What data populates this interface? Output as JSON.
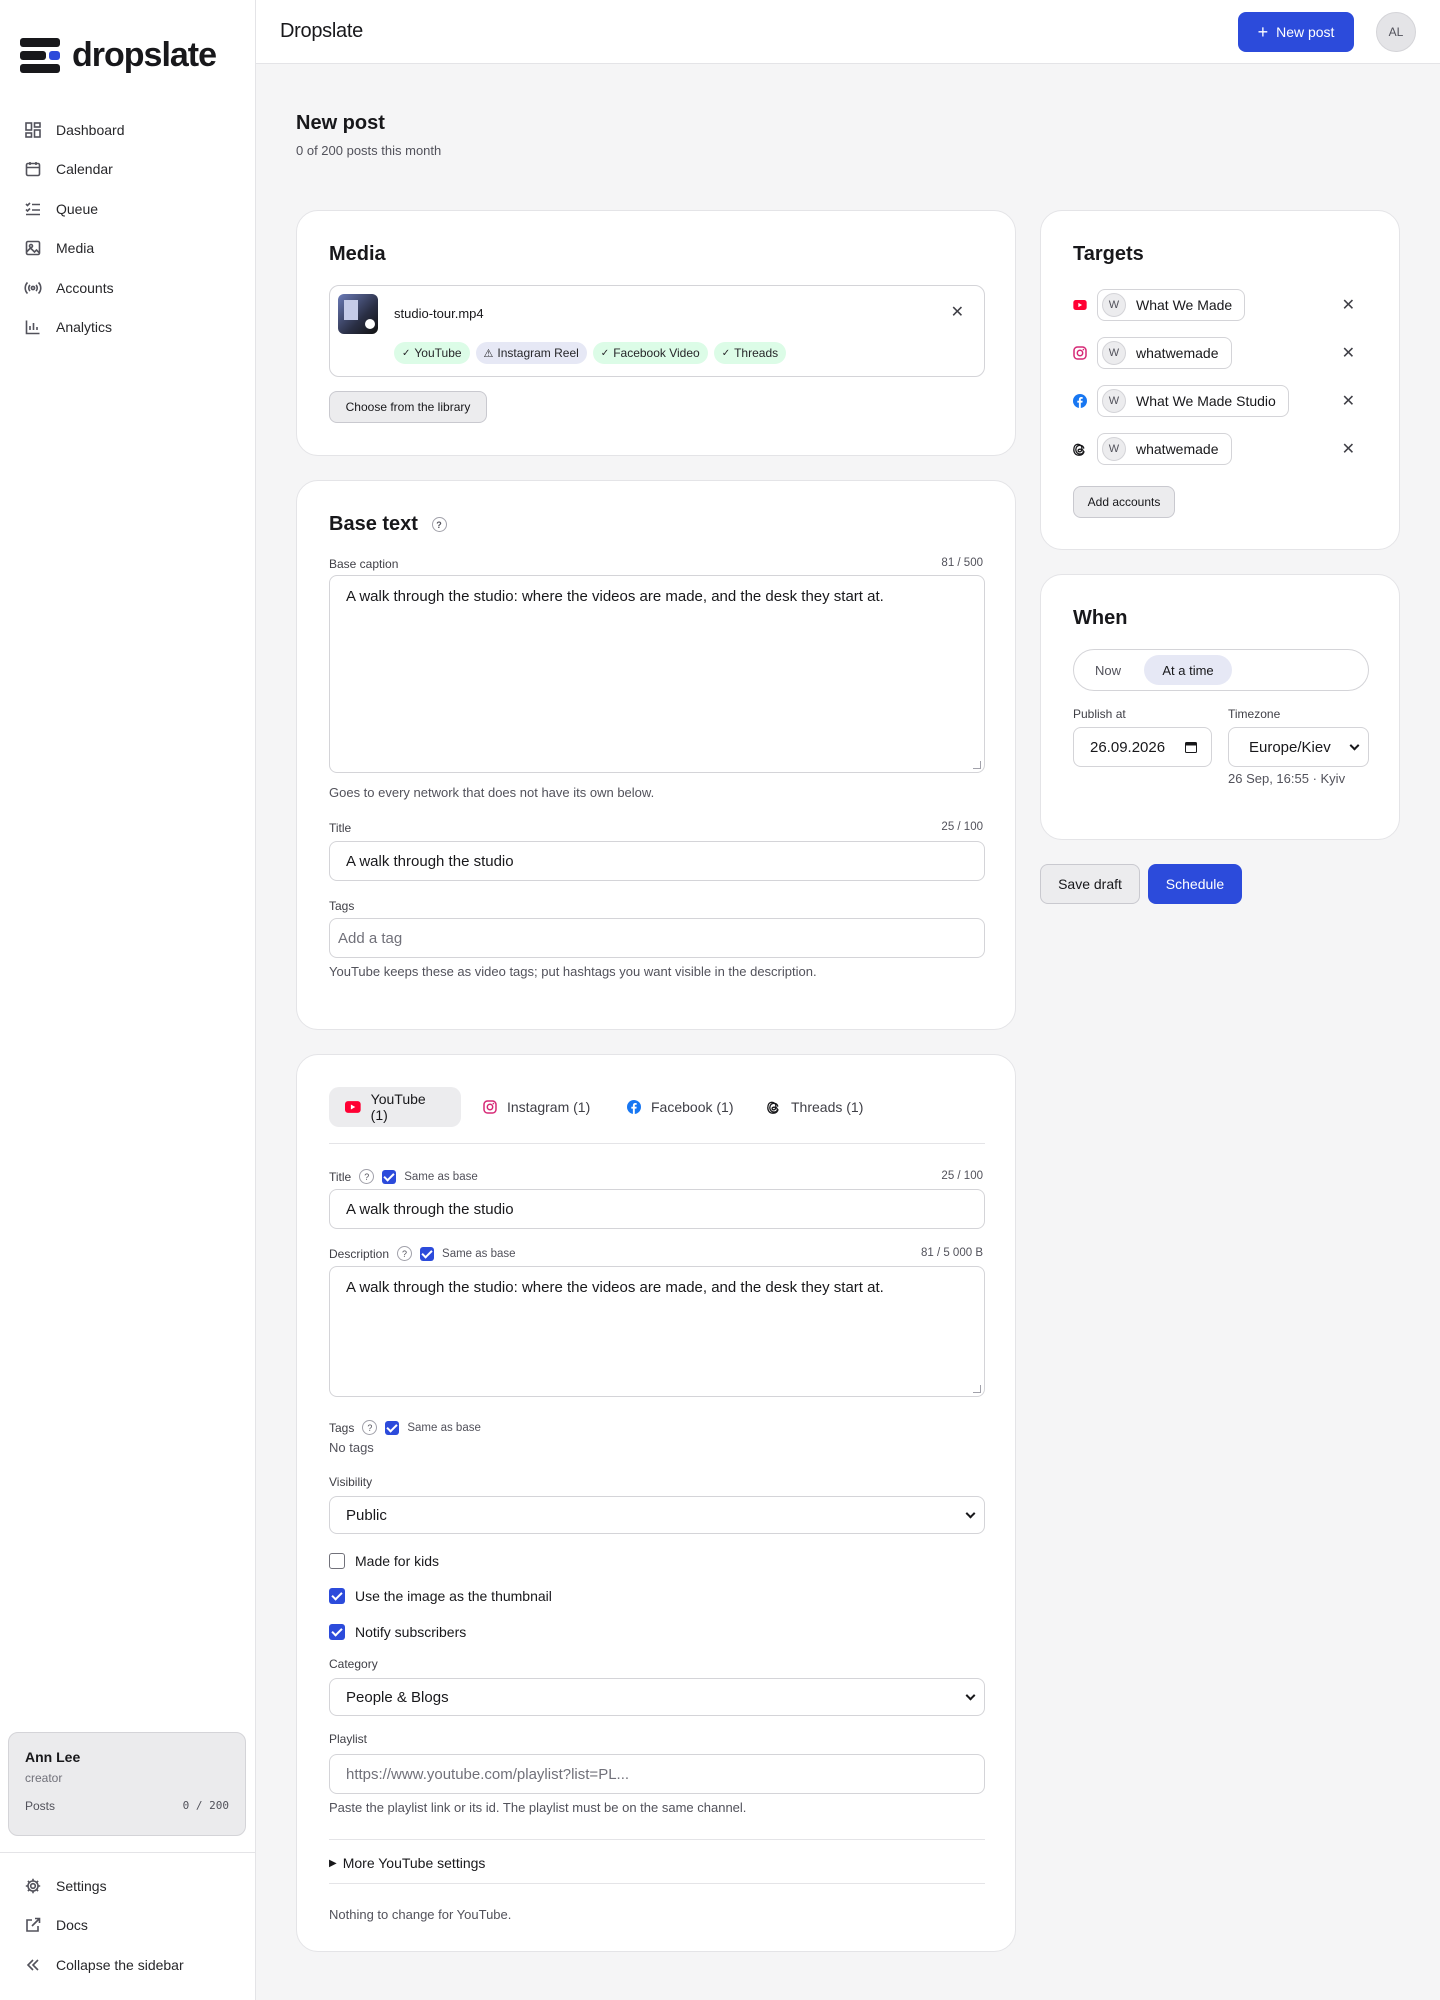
{
  "app": {
    "logo_text": "dropslate",
    "brand": "Dropslate",
    "new_post_label": "New post",
    "avatar_initials": "AL"
  },
  "sidebar": {
    "items": [
      {
        "label": "Dashboard",
        "icon": "dashboard-icon"
      },
      {
        "label": "Calendar",
        "icon": "calendar-icon"
      },
      {
        "label": "Queue",
        "icon": "queue-icon"
      },
      {
        "label": "Media",
        "icon": "image-icon"
      },
      {
        "label": "Accounts",
        "icon": "broadcast-icon"
      },
      {
        "label": "Analytics",
        "icon": "bar-chart-icon"
      }
    ],
    "user": {
      "name": "Ann Lee",
      "role": "creator",
      "posts_label": "Posts",
      "posts_count": "0 / 200"
    },
    "footer": [
      {
        "label": "Settings",
        "icon": "gear-icon"
      },
      {
        "label": "Docs",
        "icon": "external-link-icon"
      },
      {
        "label": "Collapse the sidebar",
        "icon": "chevrons-left-icon"
      }
    ]
  },
  "page": {
    "title": "New post",
    "subtitle": "0 of 200 posts this month"
  },
  "media": {
    "heading": "Media",
    "file_name": "studio-tour.mp4",
    "badges": [
      {
        "label": "YouTube",
        "status": "ok"
      },
      {
        "label": "Instagram Reel",
        "status": "warning"
      },
      {
        "label": "Facebook Video",
        "status": "ok"
      },
      {
        "label": "Threads",
        "status": "ok"
      }
    ],
    "library_button": "Choose from the library"
  },
  "base": {
    "heading": "Base text",
    "caption_label": "Base caption",
    "caption_counter": "81 / 500",
    "caption_value": "A walk through the studio: where the videos are made, and the desk they start at.",
    "caption_help": "Goes to every network that does not have its own below.",
    "title_label": "Title",
    "title_counter": "25 / 100",
    "title_value": "A walk through the studio",
    "tags_label": "Tags",
    "tags_placeholder": "Add a tag",
    "tags_help": "YouTube keeps these as video tags; put hashtags you want visible in the description."
  },
  "networks": {
    "tabs": [
      {
        "label": "YouTube (1)",
        "icon": "youtube-icon",
        "active": true
      },
      {
        "label": "Instagram (1)",
        "icon": "instagram-icon",
        "active": false
      },
      {
        "label": "Facebook (1)",
        "icon": "facebook-icon",
        "active": false
      },
      {
        "label": "Threads (1)",
        "icon": "threads-icon",
        "active": false
      }
    ],
    "youtube": {
      "title_label": "Title",
      "same_as_base": "Same as base",
      "title_counter": "25 / 100",
      "title_value": "A walk through the studio",
      "desc_label": "Description",
      "desc_counter": "81 / 5 000 B",
      "desc_value": "A walk through the studio: where the videos are made, and the desk they start at.",
      "tags_label": "Tags",
      "tags_empty": "No tags",
      "visibility_label": "Visibility",
      "visibility_value": "Public",
      "made_for_kids": "Made for kids",
      "use_thumbnail": "Use the image as the thumbnail",
      "notify": "Notify subscribers",
      "category_label": "Category",
      "category_value": "People & Blogs",
      "playlist_label": "Playlist",
      "playlist_placeholder": "https://www.youtube.com/playlist?list=PL...",
      "playlist_help": "Paste the playlist link or its id. The playlist must be on the same channel.",
      "more_settings": "More YouTube settings",
      "nothing_to_change": "Nothing to change for YouTube."
    }
  },
  "targets": {
    "heading": "Targets",
    "accounts": [
      {
        "network": "youtube-icon",
        "initial": "W",
        "name": "What We Made"
      },
      {
        "network": "instagram-icon",
        "initial": "W",
        "name": "whatwemade"
      },
      {
        "network": "facebook-icon",
        "initial": "W",
        "name": "What We Made Studio"
      },
      {
        "network": "threads-icon",
        "initial": "W",
        "name": "whatwemade"
      }
    ],
    "add_button": "Add accounts"
  },
  "when": {
    "heading": "When",
    "mode_now": "Now",
    "mode_at": "At a time",
    "publish_label": "Publish at",
    "publish_value": "26.09.2026",
    "timezone_label": "Timezone",
    "timezone_value": "Europe/Kiev",
    "local_time": "26 Sep, 16:55 · Kyiv"
  },
  "actions": {
    "save_draft": "Save draft",
    "schedule": "Schedule"
  },
  "colors": {
    "accent": "#2c4bdb",
    "youtube": "#ff0033",
    "instagram": "#d62976",
    "facebook": "#1877f2"
  }
}
